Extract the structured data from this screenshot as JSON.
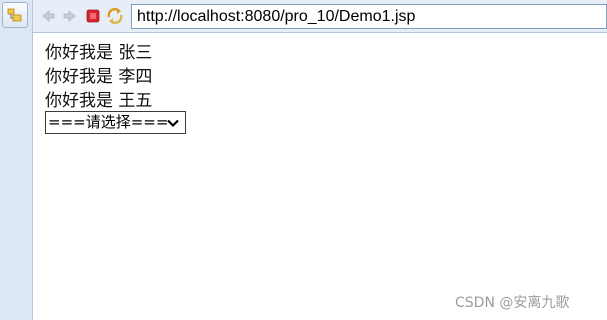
{
  "toolbar": {
    "icons": [
      "back-arrow-icon",
      "forward-arrow-icon",
      "stop-icon",
      "refresh-icon"
    ],
    "address": "http://localhost:8080/pro_10/Demo1.jsp"
  },
  "sidebar": {
    "icon": "package-explorer-icon"
  },
  "content": {
    "greetings": [
      "你好我是 张三",
      "你好我是 李四",
      "你好我是 王五"
    ],
    "select": {
      "selected": "===请选择==="
    }
  },
  "watermark": "CSDN @安离九歌",
  "colors": {
    "stop": "#d9262e",
    "toolbar_bg": "#e7eef8",
    "strip_bg": "#dde6f3"
  }
}
